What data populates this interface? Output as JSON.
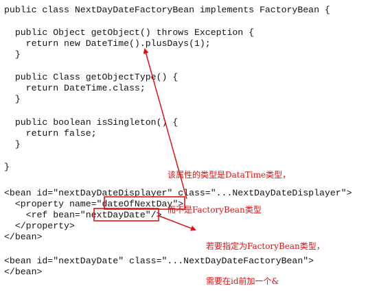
{
  "code_lines": [
    "public class NextDayDateFactoryBean implements FactoryBean {",
    "",
    "  public Object getObject() throws Exception {",
    "    return new DateTime().plusDays(1);",
    "  }",
    "",
    "  public Class getObjectType() {",
    "    return DateTime.class;",
    "  }",
    "",
    "  public boolean isSingleton() {",
    "    return false;",
    "  }",
    "",
    "}",
    "",
    "<bean id=\"nextDayDateDisplayer\" class=\"...NextDayDateDisplayer\">",
    "  <property name=\"dateOfNextDay\">",
    "    <ref bean=\"nextDayDate\"/>",
    "  </property>",
    "</bean>",
    "",
    "<bean id=\"nextDayDate\" class=\"...NextDayDateFactoryBean\">",
    "</bean>"
  ],
  "annotations": {
    "note1_line1": "该属性的类型是DataTime类型，",
    "note1_line2": "而不是FactoryBean类型",
    "note2_line1": "若要指定为FactoryBean类型，",
    "note2_line2": "需要在id前加一个&"
  },
  "colors": {
    "annotation": "#e01010",
    "code": "#111111",
    "background": "#ffffff"
  }
}
